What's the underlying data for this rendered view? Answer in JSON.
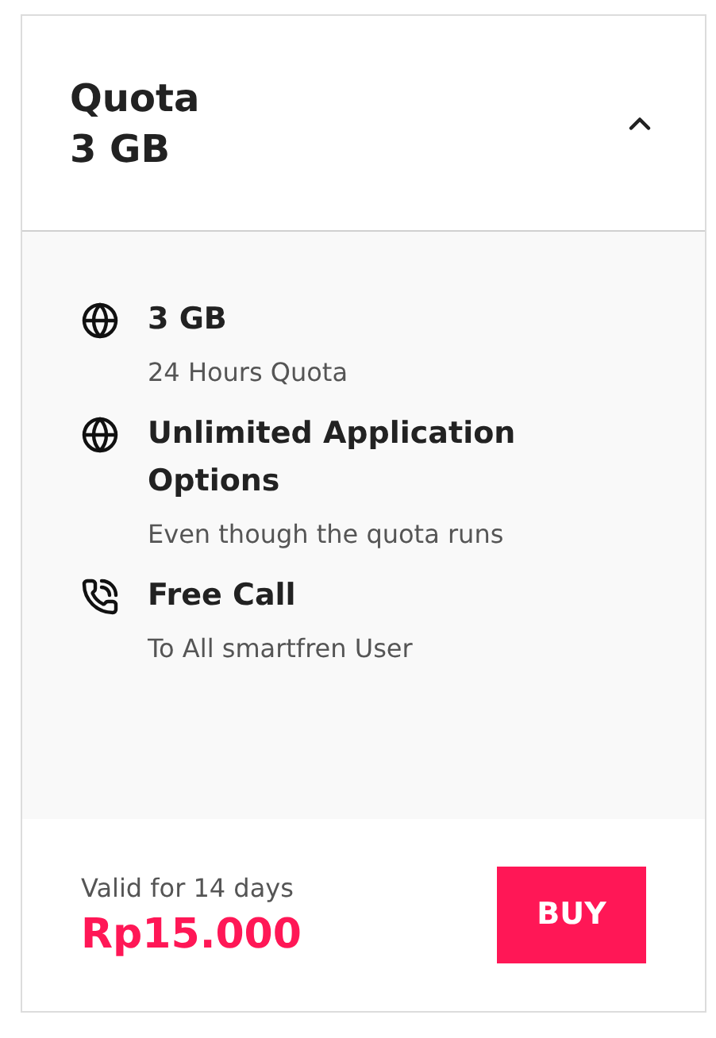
{
  "header": {
    "title": "Quota",
    "subtitle": "3 GB",
    "expanded": true
  },
  "features": [
    {
      "kind": "globe",
      "title": "3 GB",
      "description": "24 Hours Quota"
    },
    {
      "kind": "globe",
      "title": "Unlimited Application Options",
      "description": "Even though the quota runs"
    },
    {
      "kind": "phone",
      "title": "Free Call",
      "description": "To All smartfren User"
    }
  ],
  "footer": {
    "validity": "Valid for 14 days",
    "price": "Rp15.000",
    "button": "BUY"
  }
}
